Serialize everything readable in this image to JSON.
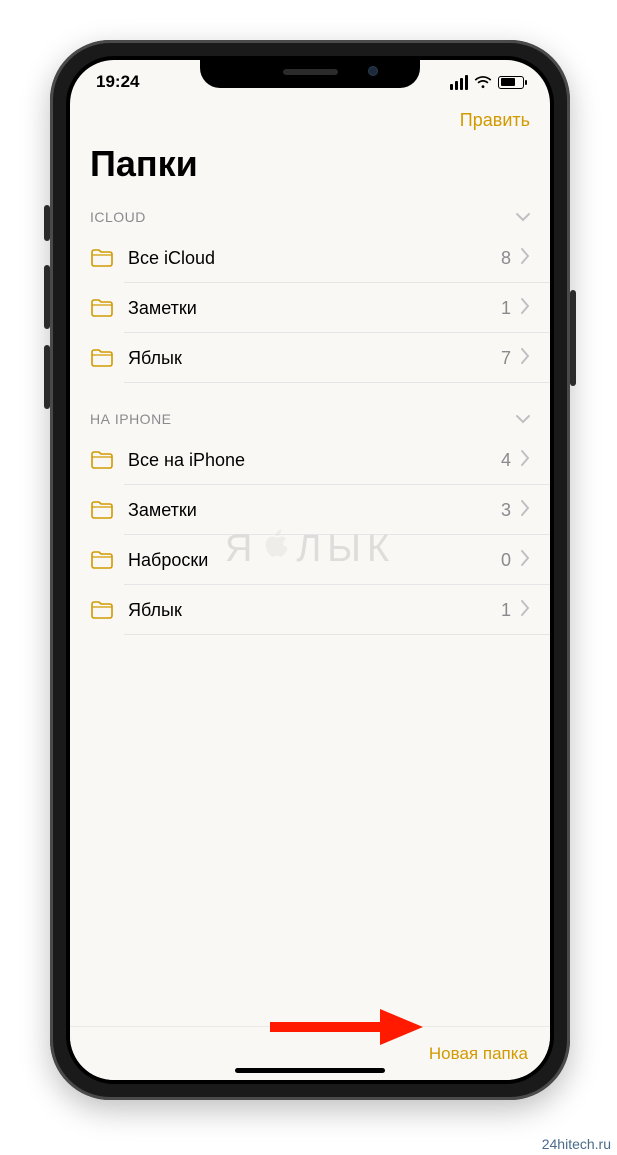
{
  "status": {
    "time": "19:24"
  },
  "navbar": {
    "edit_label": "Править"
  },
  "page": {
    "title": "Папки"
  },
  "sections": [
    {
      "header": "ICLOUD",
      "folders": [
        {
          "name": "Все iCloud",
          "count": "8"
        },
        {
          "name": "Заметки",
          "count": "1"
        },
        {
          "name": "Яблык",
          "count": "7"
        }
      ]
    },
    {
      "header": "НА IPHONE",
      "folders": [
        {
          "name": "Все на iPhone",
          "count": "4"
        },
        {
          "name": "Заметки",
          "count": "3"
        },
        {
          "name": "Наброски",
          "count": "0"
        },
        {
          "name": "Яблык",
          "count": "1"
        }
      ]
    }
  ],
  "toolbar": {
    "new_folder_label": "Новая папка"
  },
  "watermark": {
    "text_left": "Я",
    "text_right": "ЛЫК"
  },
  "attribution": {
    "text": "24hitech.ru"
  },
  "colors": {
    "accent": "#d19a00",
    "bg": "#f9f8f4",
    "separator": "#e6e6e8",
    "secondary": "#8a8a8e"
  }
}
